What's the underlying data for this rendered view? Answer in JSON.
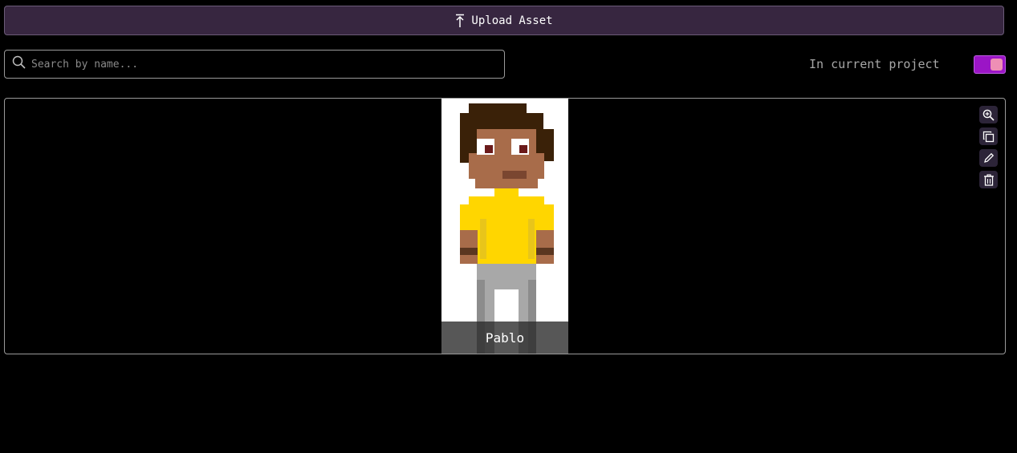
{
  "upload_button": {
    "label": "Upload Asset",
    "icon": "upload-icon"
  },
  "search": {
    "placeholder": "Search by name...",
    "value": "",
    "icon": "search-icon"
  },
  "filter": {
    "label": "In current project",
    "toggle_on": true
  },
  "assets": [
    {
      "name": "Pablo"
    }
  ],
  "asset_tools": [
    {
      "icon": "zoom-in-icon"
    },
    {
      "icon": "copy-icon"
    },
    {
      "icon": "pencil-icon"
    },
    {
      "icon": "trash-icon"
    }
  ],
  "colors": {
    "upload_bg": "#372640",
    "toggle_on": "#9b15c6",
    "toggle_knob": "#ee8fb5",
    "tool_bg": "#2c2438"
  }
}
